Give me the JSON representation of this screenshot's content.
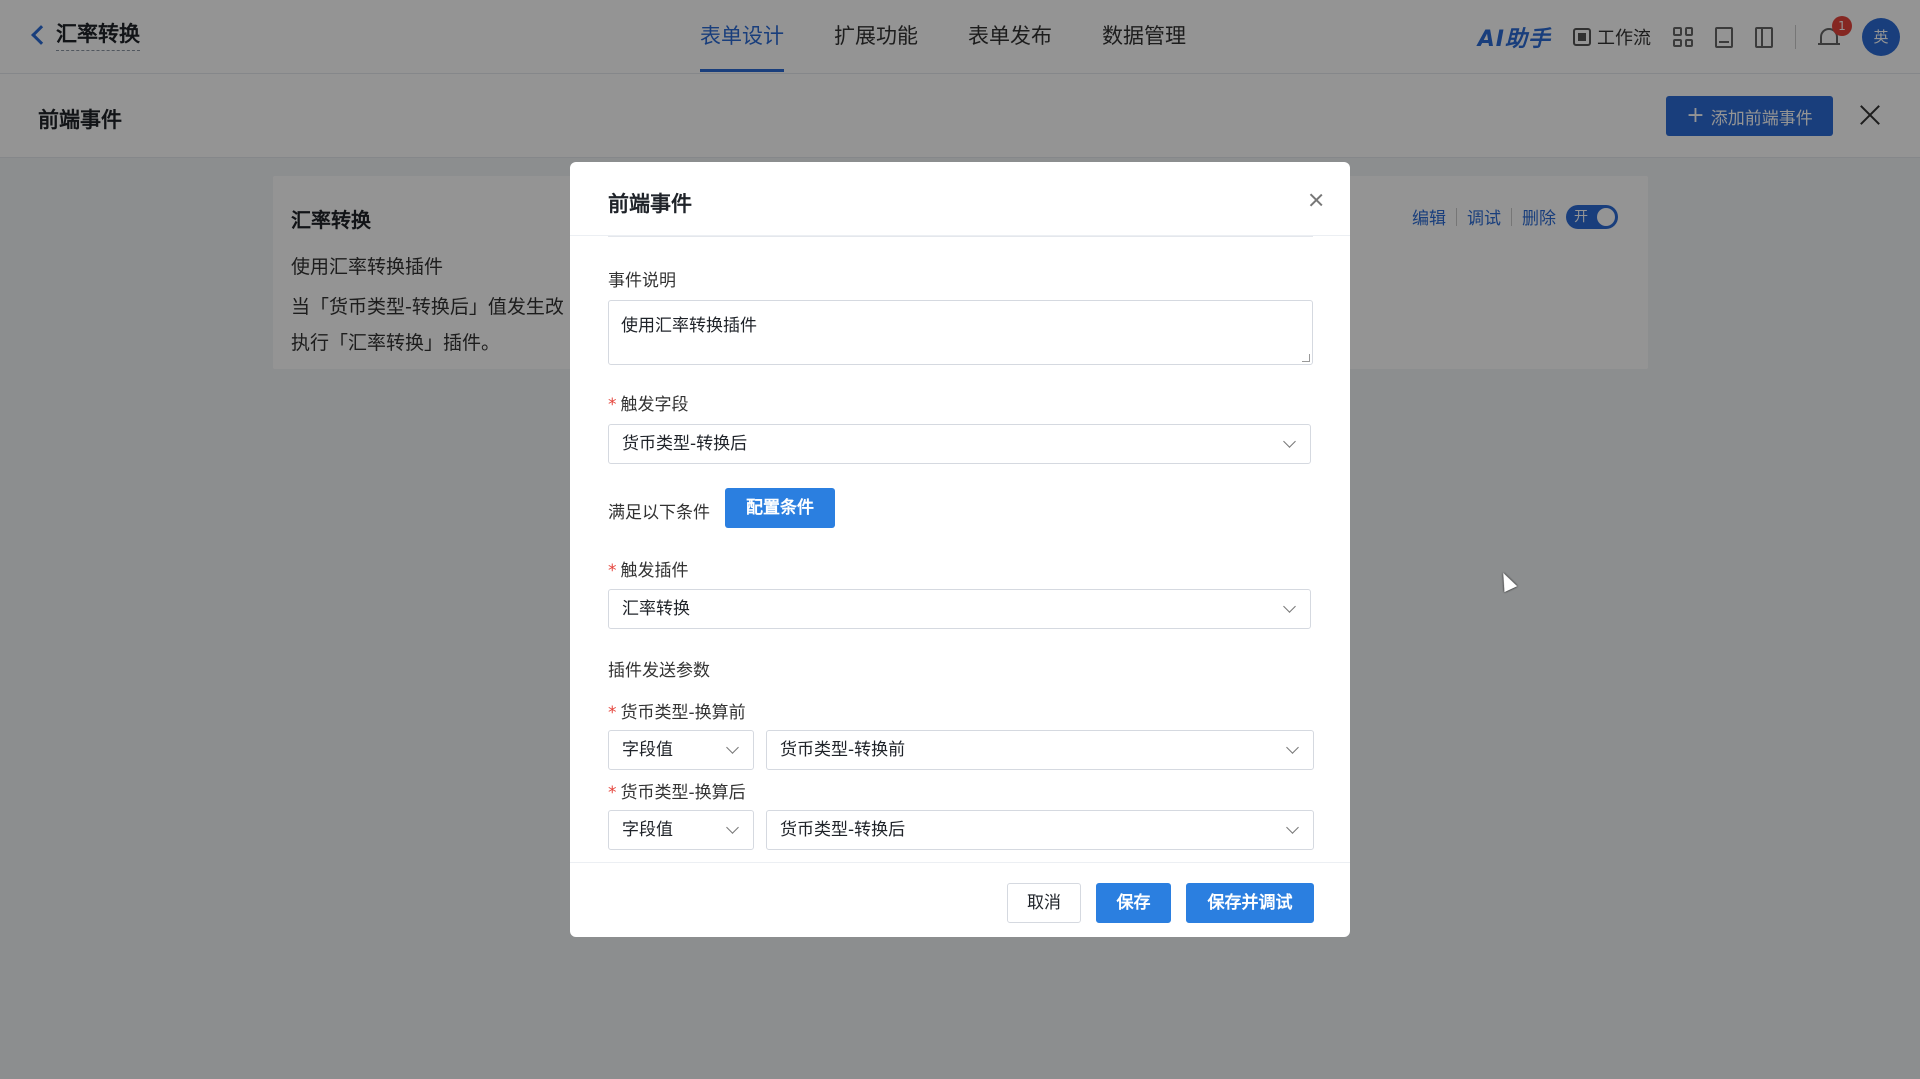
{
  "topnav": {
    "back_title": "汇率转换",
    "tabs": [
      "表单设计",
      "扩展功能",
      "表单发布",
      "数据管理"
    ],
    "active_tab": "表单设计",
    "ai_label": "AI助手",
    "workflow_label": "工作流",
    "notification_count": "1",
    "avatar_text": "英"
  },
  "drawer": {
    "title": "前端事件",
    "add_button": "添加前端事件",
    "event": {
      "title": "汇率转换",
      "description": "使用汇率转换插件",
      "line1": "当「货币类型-转换后」值发生改",
      "line2": "执行「汇率转换」插件。",
      "actions": [
        "编辑",
        "调试",
        "删除"
      ],
      "toggle_label": "开"
    }
  },
  "modal": {
    "title": "前端事件",
    "event_desc_label": "事件说明",
    "event_desc_value": "使用汇率转换插件",
    "trigger_field_label": "触发字段",
    "trigger_field_value": "货币类型-转换后",
    "condition_label": "满足以下条件",
    "condition_button": "配置条件",
    "trigger_plugin_label": "触发插件",
    "trigger_plugin_value": "汇率转换",
    "params_label": "插件发送参数",
    "params": [
      {
        "label": "货币类型-换算前",
        "type": "字段值",
        "value": "货币类型-转换前"
      },
      {
        "label": "货币类型-换算后",
        "type": "字段值",
        "value": "货币类型-转换后"
      }
    ],
    "footer": {
      "cancel": "取消",
      "save": "保存",
      "save_debug": "保存并调试"
    }
  }
}
